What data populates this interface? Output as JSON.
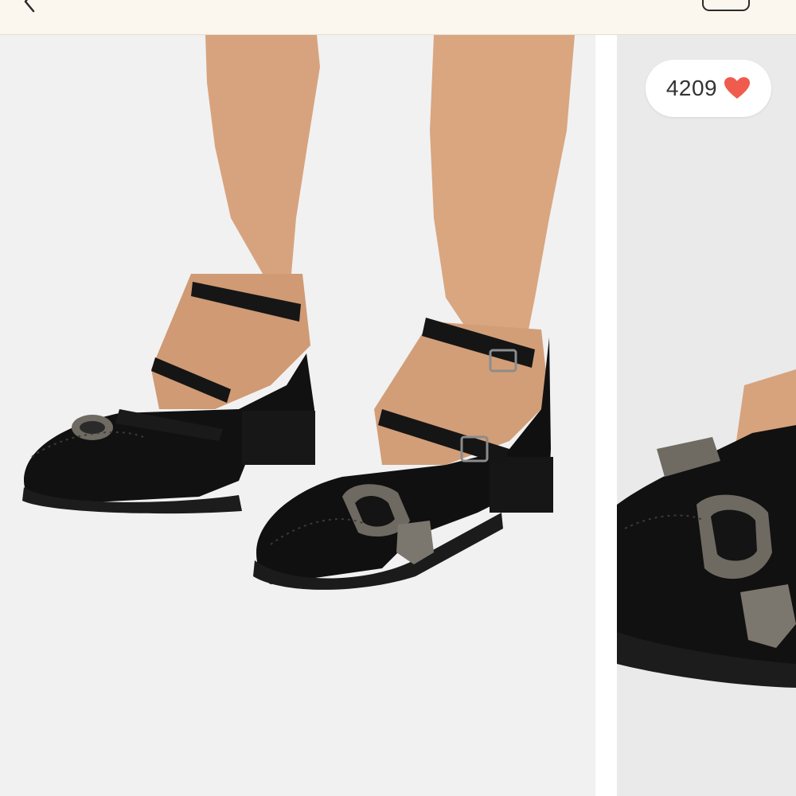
{
  "top_bar": {
    "back_icon": "chevron-left-icon",
    "action_icon": "rounded-button-icon"
  },
  "gallery": {
    "main_photo": {
      "description_icon": "product-photo"
    },
    "next_photo": {
      "description_icon": "product-photo"
    }
  },
  "likes": {
    "count": "4209",
    "icon": "heart-icon",
    "icon_color": "#ef5b4c"
  }
}
